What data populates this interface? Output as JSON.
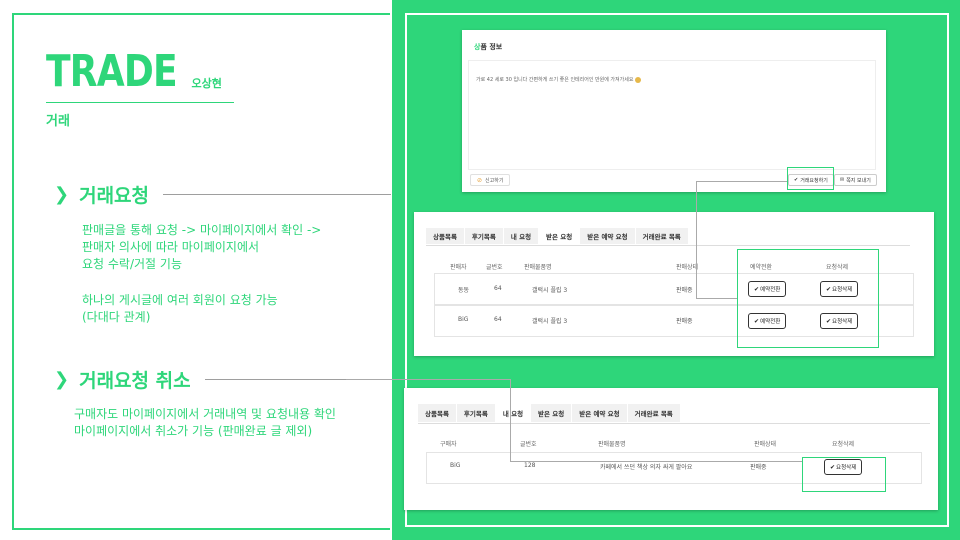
{
  "page": {
    "title": "TRADE",
    "author": "오상현",
    "subtitle": "거래"
  },
  "sections": [
    {
      "title": "거래요청",
      "lines": [
        "판매글을 통해 요청 -> 마이페이지에서 확인 ->",
        "판매자 의사에 따라 마이페이지에서",
        "요청 수락/거절 기능"
      ],
      "lines2": [
        "하나의 게시글에 여러 회원이 요청 가능",
        "(다대다 관계)"
      ]
    },
    {
      "title": "거래요청 취소",
      "lines": [
        "구매자도 마이페이지에서 거래내역 및 요청내용 확인",
        "마이페이지에서 취소가 기능 (판매완료 글 제외)"
      ]
    }
  ],
  "product_panel": {
    "title_accent": "상",
    "title_rest": "품 정보",
    "description": "가로 42 세로 30 입니다 간편하게 쓰기 좋은 인테리어인 만원에 가져가세요",
    "report_label": "신고하기",
    "request_label": "거래요청하기",
    "message_label": "쪽지 보내기"
  },
  "seller_panel": {
    "tabs": [
      "상품목록",
      "후기목록",
      "내 요청",
      "받은 요청",
      "받은 예약 요청",
      "거래완료 목록"
    ],
    "active_tab": 3,
    "headers": [
      "판매자",
      "글번호",
      "판매물품명",
      "판매상태",
      "예약전환",
      "요청삭제"
    ],
    "rows": [
      {
        "seller": "동동",
        "post_no": "64",
        "item": "갤럭시 플립 3",
        "status": "판매중",
        "convert": "예약전환",
        "delete": "요청삭제"
      },
      {
        "seller": "BiG",
        "post_no": "64",
        "item": "갤럭시 플립 3",
        "status": "판매중",
        "convert": "예약전환",
        "delete": "요청삭제"
      }
    ]
  },
  "buyer_panel": {
    "tabs": [
      "상품목록",
      "후기목록",
      "내 요청",
      "받은 요청",
      "받은 예약 요청",
      "거래완료 목록"
    ],
    "active_tab": 2,
    "headers": [
      "구매자",
      "글번호",
      "판매물품명",
      "판매상태",
      "요청삭제"
    ],
    "rows": [
      {
        "buyer": "BiG",
        "post_no": "128",
        "item": "카페에서 쓰던 책상 의자 싸게 팔아요",
        "status": "판매중",
        "delete": "요청삭제"
      }
    ]
  },
  "colors": {
    "accent": "#2ed67a",
    "panel_bg": "#ffffff",
    "connector": "#aaaaaa"
  }
}
